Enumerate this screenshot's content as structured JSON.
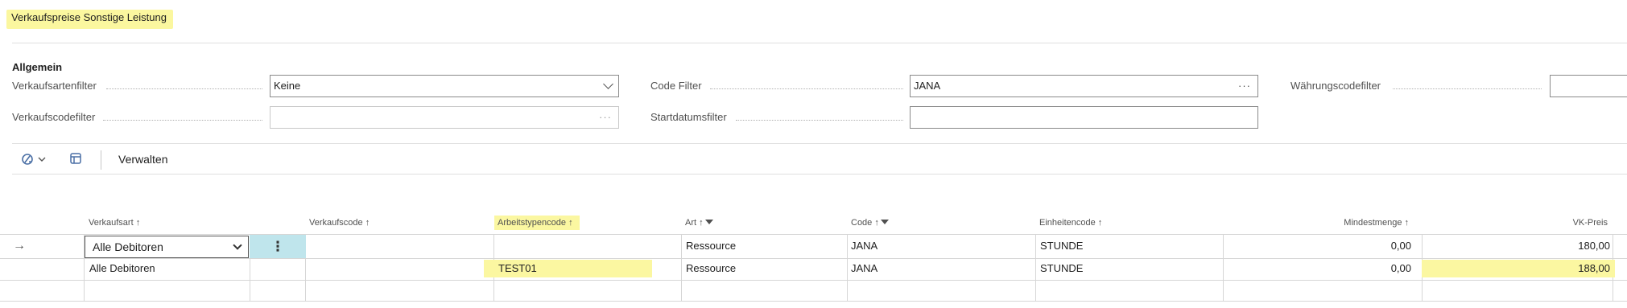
{
  "page": {
    "title": "Verkaufspreise Sonstige Leistung"
  },
  "general": {
    "section_title": "Allgemein",
    "filters": {
      "sales_type_label": "Verkaufsartenfilter",
      "sales_type_value": "Keine",
      "code_filter_label": "Code Filter",
      "code_filter_value": "JANA",
      "currency_label": "Währungscodefilter",
      "currency_value": "",
      "sales_code_label": "Verkaufscodefilter",
      "sales_code_value": "",
      "start_date_label": "Startdatumsfilter",
      "start_date_value": ""
    }
  },
  "toolbar": {
    "manage_label": "Verwalten"
  },
  "grid": {
    "columns": {
      "sales_type": "Verkaufsart",
      "sales_code": "Verkaufscode",
      "work_type": "Arbeitstypencode",
      "type": "Art",
      "code": "Code",
      "unit": "Einheitencode",
      "min_qty": "Mindestmenge",
      "price": "VK-Preis"
    },
    "sort_arrow": "↑",
    "row_arrow": "→",
    "rows": [
      {
        "sales_type": "Alle Debitoren",
        "sales_code": "",
        "work_type": "",
        "type": "Ressource",
        "code": "JANA",
        "unit": "STUNDE",
        "min_qty": "0,00",
        "price": "180,00"
      },
      {
        "sales_type": "Alle Debitoren",
        "sales_code": "",
        "work_type": "TEST01",
        "type": "Ressource",
        "code": "JANA",
        "unit": "STUNDE",
        "min_qty": "0,00",
        "price": "188,00"
      }
    ]
  },
  "colors": {
    "highlight": "#fbf7a1",
    "selected_menu": "#bfe5ec",
    "icon_accent": "#4a6fa5"
  }
}
